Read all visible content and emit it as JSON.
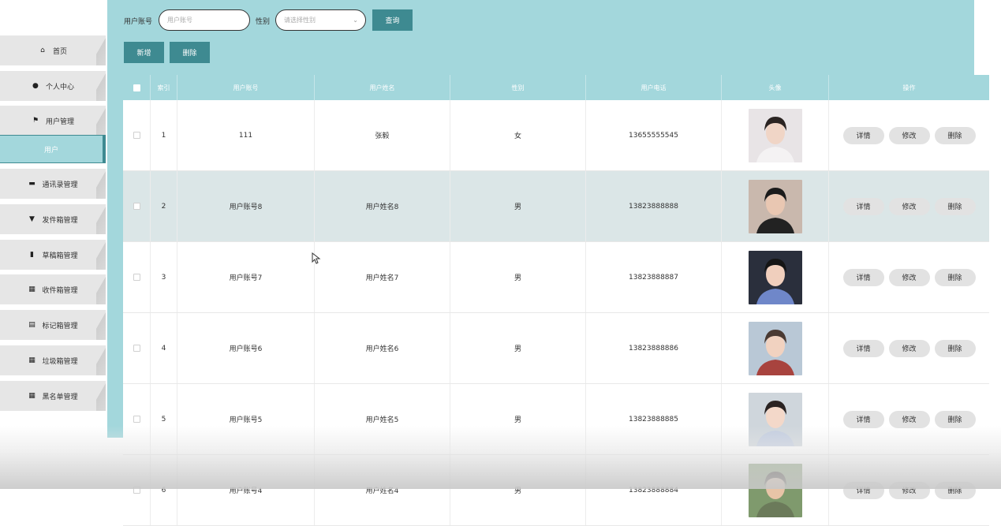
{
  "search": {
    "account_label": "用户账号",
    "account_placeholder": "用户账号",
    "gender_label": "性别",
    "gender_placeholder": "请选择性别",
    "query_button": "查询"
  },
  "actions": {
    "add_button": "新增",
    "delete_button": "删除"
  },
  "sidebar": {
    "items": [
      {
        "label": "首页",
        "icon": "home-icon",
        "glyph": "⌂"
      },
      {
        "label": "个人中心",
        "icon": "person-icon",
        "glyph": "●"
      },
      {
        "label": "用户管理",
        "icon": "flag-icon",
        "glyph": "⚑"
      },
      {
        "label": "通讯录管理",
        "icon": "briefcase-icon",
        "glyph": "▬"
      },
      {
        "label": "发件箱管理",
        "icon": "pin-icon",
        "glyph": "▼"
      },
      {
        "label": "草稿箱管理",
        "icon": "chart-icon",
        "glyph": "▮"
      },
      {
        "label": "收件箱管理",
        "icon": "grid-icon",
        "glyph": "▦"
      },
      {
        "label": "标记箱管理",
        "icon": "clipboard-icon",
        "glyph": "▤"
      },
      {
        "label": "垃圾箱管理",
        "icon": "grid-icon",
        "glyph": "▦"
      },
      {
        "label": "黑名单管理",
        "icon": "grid-icon",
        "glyph": "▦"
      }
    ],
    "sub_item": "用户"
  },
  "table": {
    "headers": [
      "索引",
      "用户账号",
      "用户姓名",
      "性别",
      "用户电话",
      "头像",
      "操作"
    ],
    "row_buttons": {
      "detail": "详情",
      "edit": "修改",
      "delete": "删除"
    },
    "rows": [
      {
        "index": "1",
        "account": "111",
        "name": "张毅",
        "gender": "女",
        "phone": "13655555545",
        "avatar": "avatar-woman-white",
        "highlight": false
      },
      {
        "index": "2",
        "account": "用户账号8",
        "name": "用户姓名8",
        "gender": "男",
        "phone": "13823888888",
        "avatar": "avatar-man-black",
        "highlight": true
      },
      {
        "index": "3",
        "account": "用户账号7",
        "name": "用户姓名7",
        "gender": "男",
        "phone": "13823888887",
        "avatar": "avatar-man-blue",
        "highlight": false
      },
      {
        "index": "4",
        "account": "用户账号6",
        "name": "用户姓名6",
        "gender": "男",
        "phone": "13823888886",
        "avatar": "avatar-man-striped",
        "highlight": false
      },
      {
        "index": "5",
        "account": "用户账号5",
        "name": "用户姓名5",
        "gender": "男",
        "phone": "13823888885",
        "avatar": "avatar-woman-light",
        "highlight": false
      },
      {
        "index": "6",
        "account": "用户账号4",
        "name": "用户姓名4",
        "gender": "男",
        "phone": "13823888884",
        "avatar": "avatar-man-outdoor",
        "highlight": false
      }
    ]
  },
  "colors": {
    "accent": "#a3d7dc",
    "button": "#3e8a91",
    "highlight_row": "#dbe6e7"
  }
}
